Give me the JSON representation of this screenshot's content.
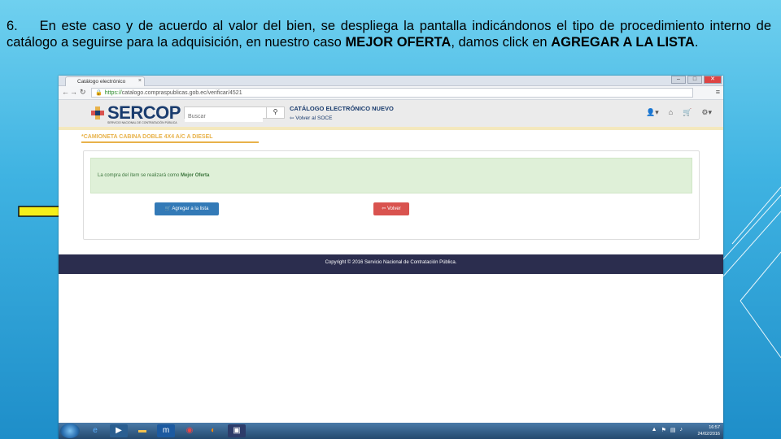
{
  "slide": {
    "step_number": "6.",
    "text_part1": "En este caso y de acuerdo al valor del bien, se despliega la pantalla indicándonos el tipo de procedimiento interno de catálogo a seguirse para la adquisición, en nuestro caso ",
    "text_highlight1": "MEJOR OFERTA",
    "text_part2": ", damos click en ",
    "text_highlight2": "AGREGAR A LA LISTA",
    "text_part3": "."
  },
  "browser": {
    "tab_title": "Catálogo electrónico",
    "tab_close": "×",
    "url_https": "https://",
    "url_rest": "catalogo.compraspublicas.gob.ec/verificar/4521",
    "window_controls": [
      "–",
      "□",
      "✕"
    ]
  },
  "site": {
    "logo_name": "SERCOP",
    "logo_tagline": "SERVICIO NACIONAL DE CONTRATACIÓN PÚBLICA",
    "search_placeholder": "Buscar",
    "catalog_title": "CATÁLOGO ELECTRÓNICO NUEVO",
    "back_to_soce": "Volver al SOCE"
  },
  "content": {
    "product_title": "*CAMIONETA CABINA DOBLE 4X4 A/C A DIESEL",
    "alert_text": "La compra del ítem se realizará como ",
    "alert_bold": "Mejor Oferta",
    "add_button": "Agregar a la lista",
    "back_button": "Volver",
    "footer": "Copyright © 2016 Servicio Nacional de Contratación Pública."
  },
  "taskbar": {
    "time": "16:57",
    "date": "24/02/2016"
  },
  "colors": {
    "brand_blue": "#1a3c6e",
    "accent_orange": "#e8b24a",
    "primary_button": "#337ab7",
    "danger_button": "#d9534f",
    "footer_bg": "#2b2d4e",
    "alert_bg": "#dff0d8",
    "arrow_fill": "#f5ef1a"
  }
}
